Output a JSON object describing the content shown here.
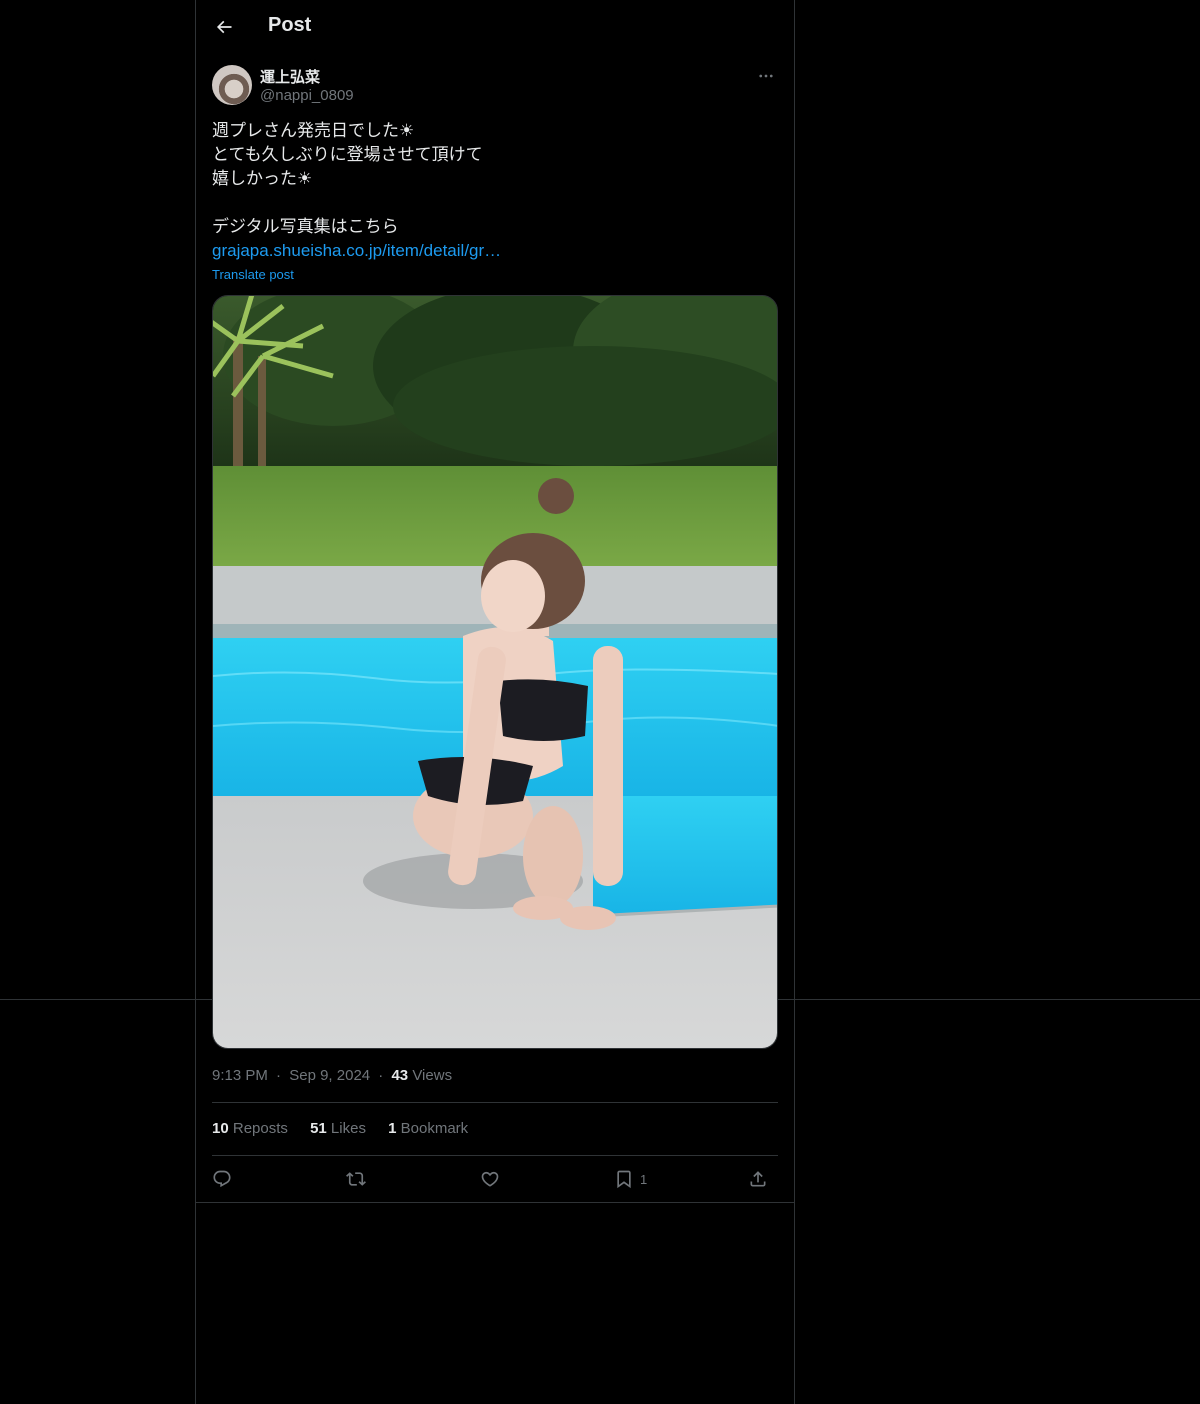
{
  "header": {
    "title": "Post",
    "back_icon": "arrow-left-icon"
  },
  "author": {
    "display_name": "運上弘菜",
    "handle": "@nappi_0809",
    "more_icon": "more-horizontal-icon"
  },
  "tweet": {
    "lines": [
      "週プレさん発売日でした☀",
      "とても久しぶりに登場させて頂けて",
      "嬉しかった☀",
      "",
      "デジタル写真集はこちら"
    ],
    "link_text": "grajapa.shueisha.co.jp/item/detail/gr…",
    "translate_label": "Translate post"
  },
  "meta": {
    "time": "9:13 PM",
    "date": "Sep 9, 2024",
    "views_count": "43",
    "views_label": "Views",
    "separator": "·"
  },
  "stats": {
    "reposts_count": "10",
    "reposts_label": "Reposts",
    "likes_count": "51",
    "likes_label": "Likes",
    "bookmarks_count": "1",
    "bookmarks_label": "Bookmark"
  },
  "actions": {
    "reply_icon": "reply-icon",
    "repost_icon": "repost-icon",
    "like_icon": "heart-icon",
    "bookmark_icon": "bookmark-icon",
    "bookmark_count": "1",
    "share_icon": "share-icon"
  },
  "colors": {
    "background": "#000000",
    "text_primary": "#e7e9ea",
    "text_secondary": "#71767b",
    "link": "#1d9bf0",
    "border": "#2f3336"
  }
}
